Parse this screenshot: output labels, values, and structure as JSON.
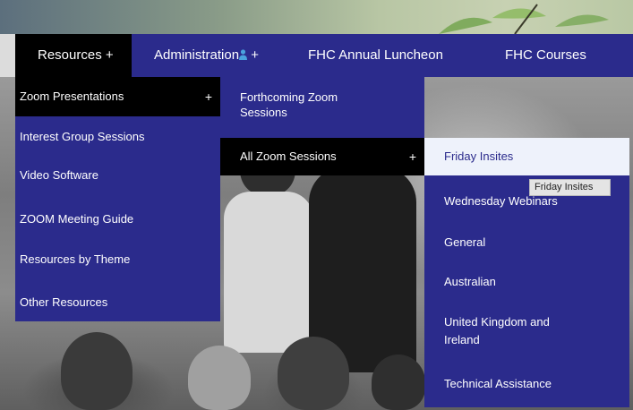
{
  "nav": {
    "resources": "Resources +",
    "administration": "Administration",
    "administration_plus": " +",
    "luncheon": "FHC Annual Luncheon",
    "courses": "FHC Courses"
  },
  "menu_l1": {
    "zoom": "Zoom Presentations",
    "zoom_plus": "+",
    "interest": "Interest Group Sessions",
    "video": "Video Software",
    "guide": "ZOOM Meeting Guide",
    "theme": "Resources by Theme",
    "other": "Other Resources"
  },
  "menu_l2": {
    "forthcoming_line1": "Forthcoming Zoom",
    "forthcoming_line2": "Sessions",
    "all": "All Zoom Sessions",
    "all_plus": "+"
  },
  "menu_l3": {
    "friday": "Friday Insites",
    "wednesday": "Wednesday Webinars",
    "general": "General",
    "australian": "Australian",
    "uk_line1": "United Kingdom and",
    "uk_line2": "Ireland",
    "technical": "Technical Assistance"
  },
  "tooltip": "Friday Insites",
  "colors": {
    "nav_bg": "#2b2b8c",
    "active_bg": "#000000",
    "hover_bg": "#eef2fb",
    "admin_icon": "#4aa3df"
  },
  "icons": {
    "admin": "person-icon"
  }
}
